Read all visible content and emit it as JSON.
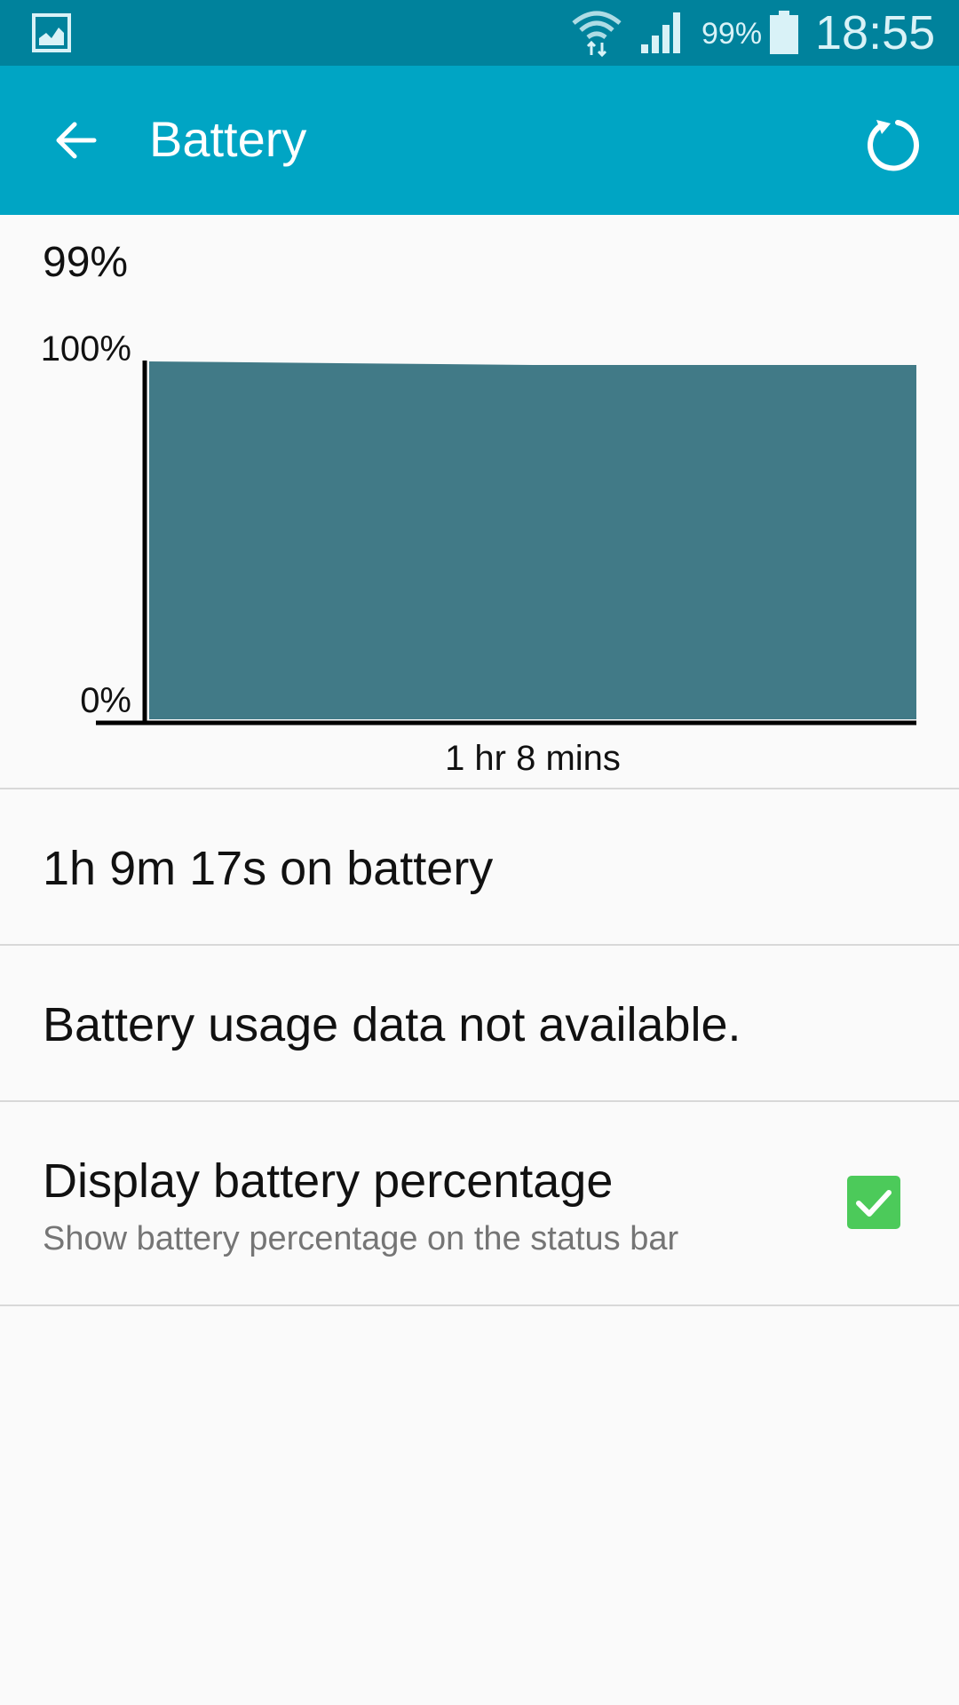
{
  "status_bar": {
    "battery_percent": "99%",
    "time": "18:55"
  },
  "app_bar": {
    "title": "Battery"
  },
  "battery": {
    "level_label": "99%"
  },
  "chart_data": {
    "type": "area",
    "y_tick_labels": [
      "100%",
      "0%"
    ],
    "ylim": [
      0,
      100
    ],
    "x_label": "1 hr 8 mins",
    "x": [
      0,
      0.5,
      1
    ],
    "values": [
      100,
      99,
      99
    ]
  },
  "stats": {
    "on_battery": "1h 9m 17s on battery",
    "usage_message": "Battery usage data not available."
  },
  "settings": {
    "display_percentage": {
      "title": "Display battery percentage",
      "summary": "Show battery percentage on the status bar",
      "checked": true
    }
  },
  "colors": {
    "status_bar": "#00829c",
    "app_bar": "#00a5c4",
    "chart_fill": "#417a87",
    "checkbox": "#4cca5a"
  }
}
